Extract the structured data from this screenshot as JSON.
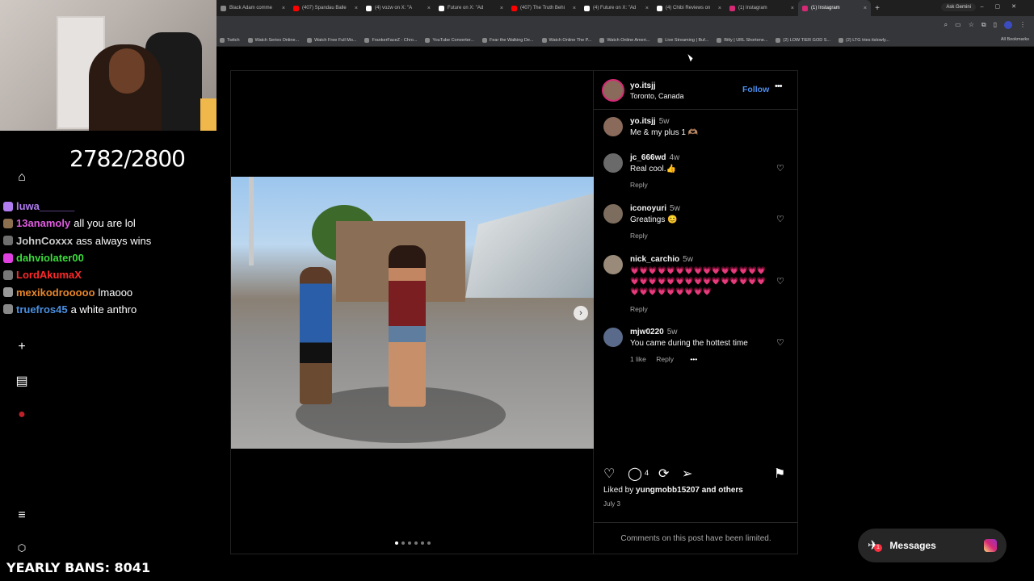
{
  "browser": {
    "tabs": [
      {
        "title": "Black Adam comme",
        "color": "#888888"
      },
      {
        "title": "(407) Spandau Balle",
        "color": "#ff0000"
      },
      {
        "title": "(4) vozw on X: \"A",
        "color": "#ffffff"
      },
      {
        "title": "Future on X: \"Ad",
        "color": "#ffffff"
      },
      {
        "title": "(407) The Truth Behi",
        "color": "#ff0000"
      },
      {
        "title": "(4) Future on X: \"Ad",
        "color": "#ffffff"
      },
      {
        "title": "(4) Chibi Reviews on",
        "color": "#ffffff"
      },
      {
        "title": "(1) Instagram",
        "color": "#d62976"
      },
      {
        "title": "(1) Instagram",
        "color": "#d62976"
      }
    ],
    "new_tab_label": "+",
    "gemini_label": "Ask Gemini",
    "bookmarks": [
      "Twitch",
      "Watch Series Online...",
      "Watch Free Full Mo...",
      "FrankerFaceZ - Chro...",
      "YouTube Converter...",
      "Fear the Walking De...",
      "Watch Online The P...",
      "Watch Online Ameri...",
      "Live Streaming | Buf...",
      "Bitly | URL Shortene...",
      "(2) LOW TIER GOD S...",
      "(2) LTG tries itslowly..."
    ],
    "all_bookmarks_label": "All Bookmarks"
  },
  "stream": {
    "counter": "2782/2800",
    "yearly_bans": "YEARLY BANS: 8041",
    "chat": [
      {
        "user": "luwa______",
        "message": "",
        "color": "#b07cf0",
        "badge": "#b07cf0"
      },
      {
        "user": "13anamoly",
        "message": "all you are lol",
        "color": "#e05ce0",
        "badge": "#8c6f4e"
      },
      {
        "user": "JohnCoxxx",
        "message": "ass always wins",
        "color": "#c9c9c9",
        "badge": "#6e6e6e"
      },
      {
        "user": "dahviolater00",
        "message": "",
        "color": "#3cdc3c",
        "badge": "#e040e0"
      },
      {
        "user": "LordAkumaX",
        "message": "",
        "color": "#ff2a2a",
        "badge": "#777777"
      },
      {
        "user": "mexikodrooooo",
        "message": "lmaooo",
        "color": "#e8862a",
        "badge": "#999999"
      },
      {
        "user": "truefros45",
        "message": "a white anthro",
        "color": "#4a90e2",
        "badge": "#888888"
      }
    ]
  },
  "post": {
    "author": "yo.itsjj",
    "location": "Toronto, Canada",
    "follow_label": "Follow",
    "more_label": "•••",
    "caption": {
      "user": "yo.itsjj",
      "ago": "5w",
      "text": "Me & my plus 1 🫶🏽"
    },
    "comments": [
      {
        "user": "jc_666wd",
        "ago": "4w",
        "text": "Real cool.👍",
        "reply": "Reply"
      },
      {
        "user": "iconoyuri",
        "ago": "5w",
        "text": "Greatings 😊",
        "reply": "Reply"
      },
      {
        "user": "nick_carchio",
        "ago": "5w",
        "text": "💗💗💗💗💗💗💗💗💗💗💗💗💗💗💗💗💗💗💗💗💗💗💗💗💗💗💗💗💗💗💗💗💗💗💗💗💗💗💗",
        "reply": "Reply"
      },
      {
        "user": "mjw0220",
        "ago": "5w",
        "text": "You came during the hottest time",
        "likes": "1 like",
        "reply": "Reply"
      }
    ],
    "comment_count": "4",
    "liked_by_prefix": "Liked by",
    "liked_by_user": "yungmobb15207",
    "liked_by_suffix": "and others",
    "date": "July 3",
    "limited_notice": "Comments on this post have been limited.",
    "slides": 6,
    "active_slide": 1
  },
  "messages_label": "Messages",
  "messages_badge": "1"
}
